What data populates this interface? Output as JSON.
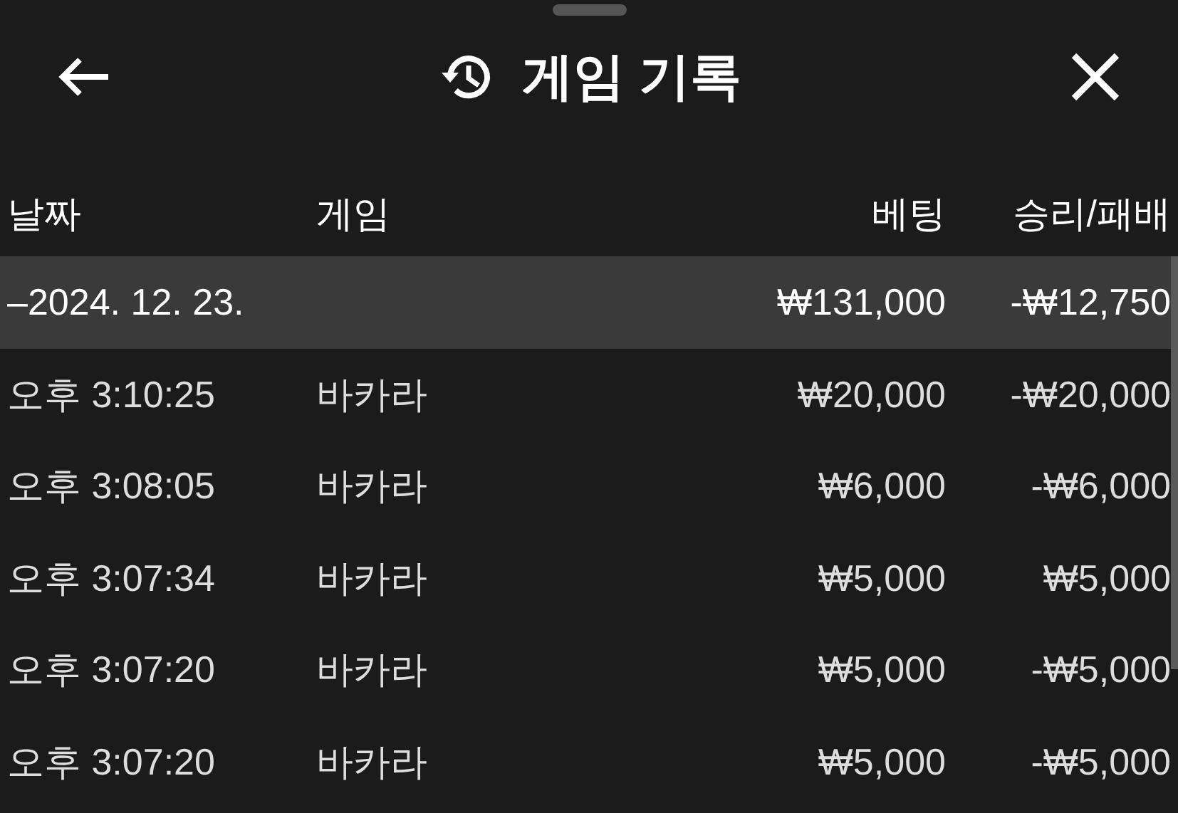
{
  "header": {
    "title": "게임 기록"
  },
  "table": {
    "columns": [
      "날짜",
      "게임",
      "베팅",
      "승리/패배"
    ],
    "group": {
      "date": "–2024. 12. 23.",
      "bet": "₩131,000",
      "result": "-₩12,750"
    },
    "rows": [
      {
        "time": "오후 3:10:25",
        "game": "바카라",
        "bet": "₩20,000",
        "result": "-₩20,000"
      },
      {
        "time": "오후 3:08:05",
        "game": "바카라",
        "bet": "₩6,000",
        "result": "-₩6,000"
      },
      {
        "time": "오후 3:07:34",
        "game": "바카라",
        "bet": "₩5,000",
        "result": "₩5,000"
      },
      {
        "time": "오후 3:07:20",
        "game": "바카라",
        "bet": "₩5,000",
        "result": "-₩5,000"
      },
      {
        "time": "오후 3:07:20",
        "game": "바카라",
        "bet": "₩5,000",
        "result": "-₩5,000"
      }
    ]
  }
}
